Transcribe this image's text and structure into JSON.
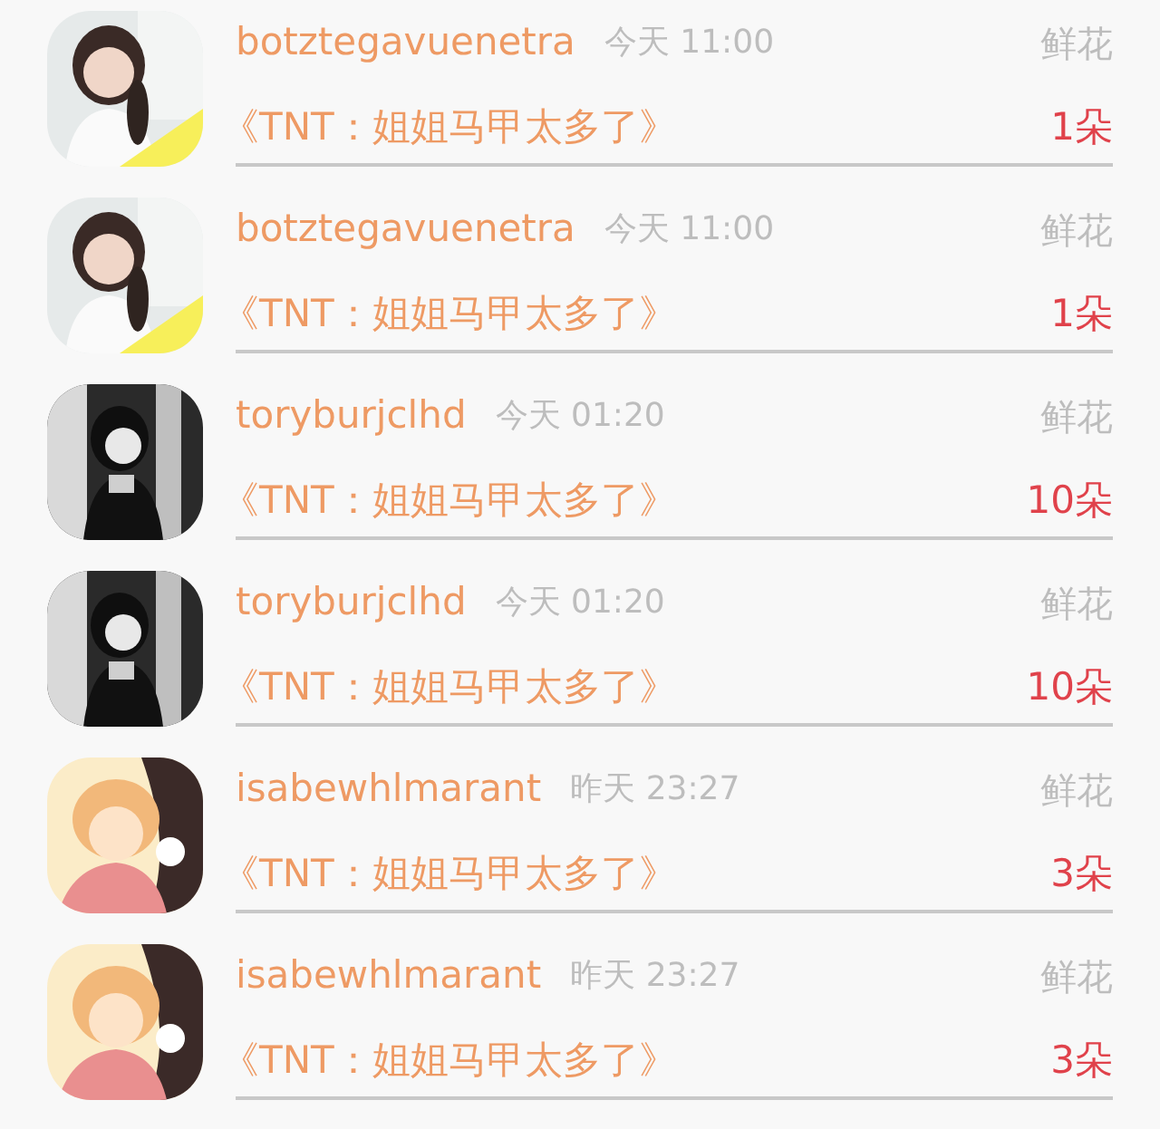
{
  "gifts": [
    {
      "user": "botztegavuenetra",
      "time": "今天 11:00",
      "gift": "鲜花",
      "title": "《TNT：姐姐马甲太多了》",
      "count": "1朵"
    },
    {
      "user": "botztegavuenetra",
      "time": "今天 11:00",
      "gift": "鲜花",
      "title": "《TNT：姐姐马甲太多了》",
      "count": "1朵"
    },
    {
      "user": "toryburjclhd",
      "time": "今天 01:20",
      "gift": "鲜花",
      "title": "《TNT：姐姐马甲太多了》",
      "count": "10朵"
    },
    {
      "user": "toryburjclhd",
      "time": "今天 01:20",
      "gift": "鲜花",
      "title": "《TNT：姐姐马甲太多了》",
      "count": "10朵"
    },
    {
      "user": "isabewhlmarant",
      "time": "昨天 23:27",
      "gift": "鲜花",
      "title": "《TNT：姐姐马甲太多了》",
      "count": "3朵"
    },
    {
      "user": "isabewhlmarant",
      "time": "昨天 23:27",
      "gift": "鲜花",
      "title": "《TNT：姐姐马甲太多了》",
      "count": "3朵"
    }
  ]
}
